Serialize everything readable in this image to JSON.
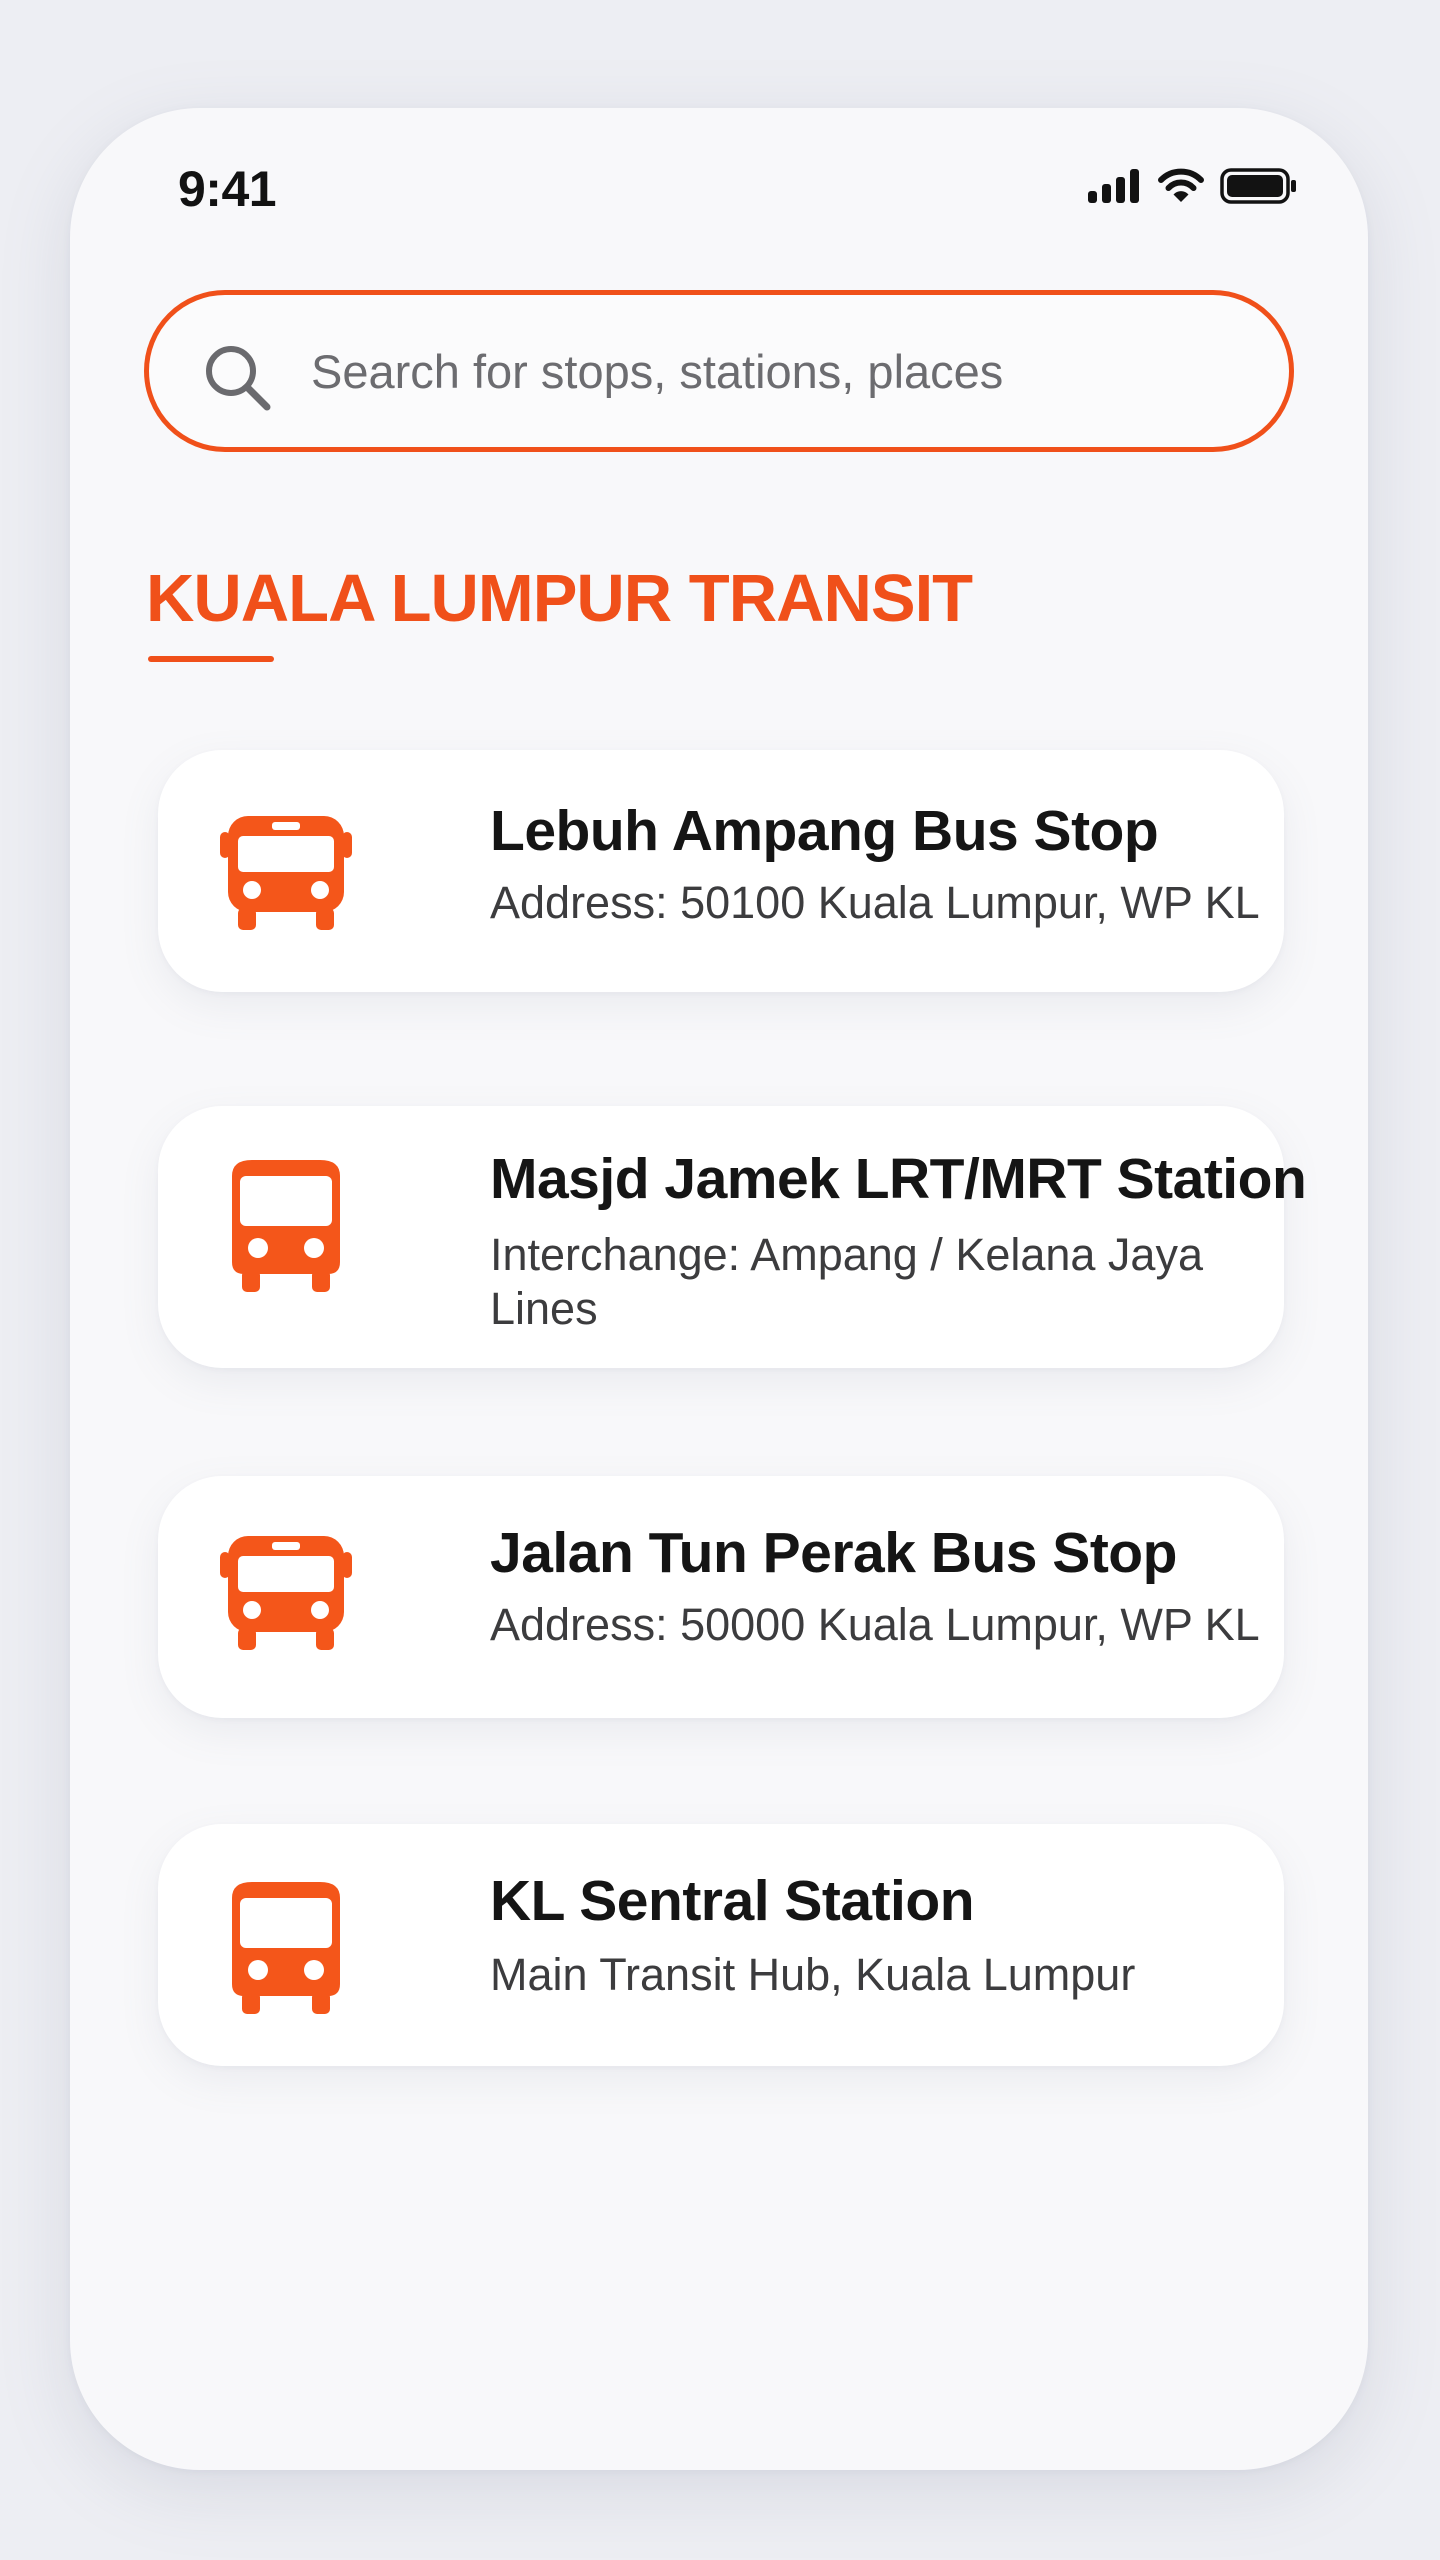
{
  "status_bar": {
    "time": "9:41"
  },
  "search": {
    "placeholder": "Search for stops, stations, places"
  },
  "section": {
    "title": "KUALA LUMPUR TRANSIT"
  },
  "theme": {
    "accent": "#f0501a",
    "icon_color": "#f4561a"
  },
  "stops": [
    {
      "name": "Lebuh Ampang Bus Stop",
      "detail": "Address: 50100 Kuala Lumpur, WP KL",
      "icon": "bus-icon"
    },
    {
      "name": "Masjd Jamek LRT/MRT Station",
      "detail": "Interchange: Ampang / Kelana Jaya Lines",
      "icon": "train-icon"
    },
    {
      "name": "Jalan Tun Perak Bus Stop",
      "detail": "Address: 50000 Kuala Lumpur, WP KL",
      "icon": "bus-icon"
    },
    {
      "name": "KL Sentral Station",
      "detail": "Main Transit Hub, Kuala Lumpur",
      "icon": "train-icon"
    }
  ]
}
